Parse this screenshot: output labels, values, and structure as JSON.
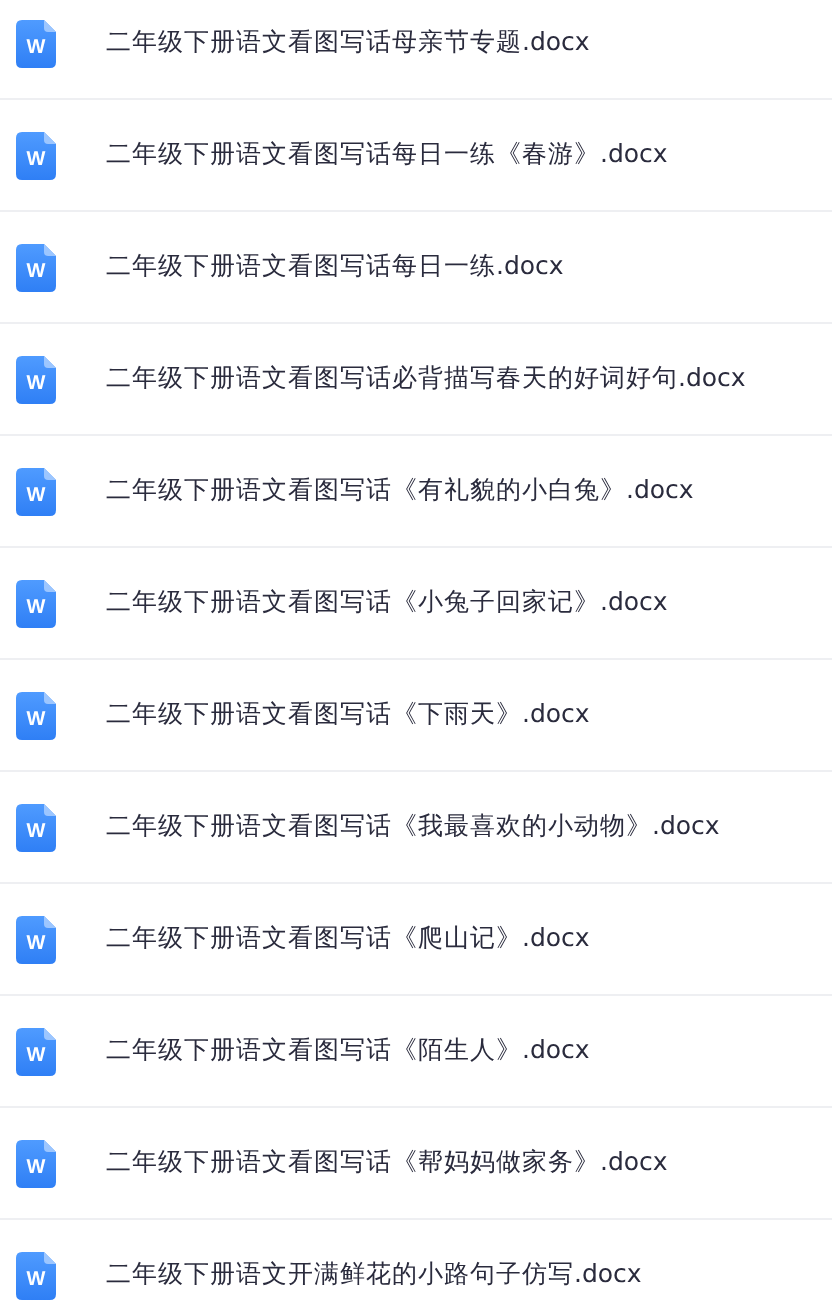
{
  "files": [
    {
      "icon_label": "W",
      "name": "二年级下册语文看图写话母亲节专题.docx"
    },
    {
      "icon_label": "W",
      "name": "二年级下册语文看图写话每日一练《春游》.docx"
    },
    {
      "icon_label": "W",
      "name": "二年级下册语文看图写话每日一练.docx"
    },
    {
      "icon_label": "W",
      "name": "二年级下册语文看图写话必背描写春天的好词好句.docx"
    },
    {
      "icon_label": "W",
      "name": "二年级下册语文看图写话《有礼貌的小白兔》.docx"
    },
    {
      "icon_label": "W",
      "name": "二年级下册语文看图写话《小兔子回家记》.docx"
    },
    {
      "icon_label": "W",
      "name": "二年级下册语文看图写话《下雨天》.docx"
    },
    {
      "icon_label": "W",
      "name": "二年级下册语文看图写话《我最喜欢的小动物》.docx"
    },
    {
      "icon_label": "W",
      "name": "二年级下册语文看图写话《爬山记》.docx"
    },
    {
      "icon_label": "W",
      "name": "二年级下册语文看图写话《陌生人》.docx"
    },
    {
      "icon_label": "W",
      "name": "二年级下册语文看图写话《帮妈妈做家务》.docx"
    },
    {
      "icon_label": "W",
      "name": "二年级下册语文开满鲜花的小路句子仿写.docx"
    }
  ]
}
